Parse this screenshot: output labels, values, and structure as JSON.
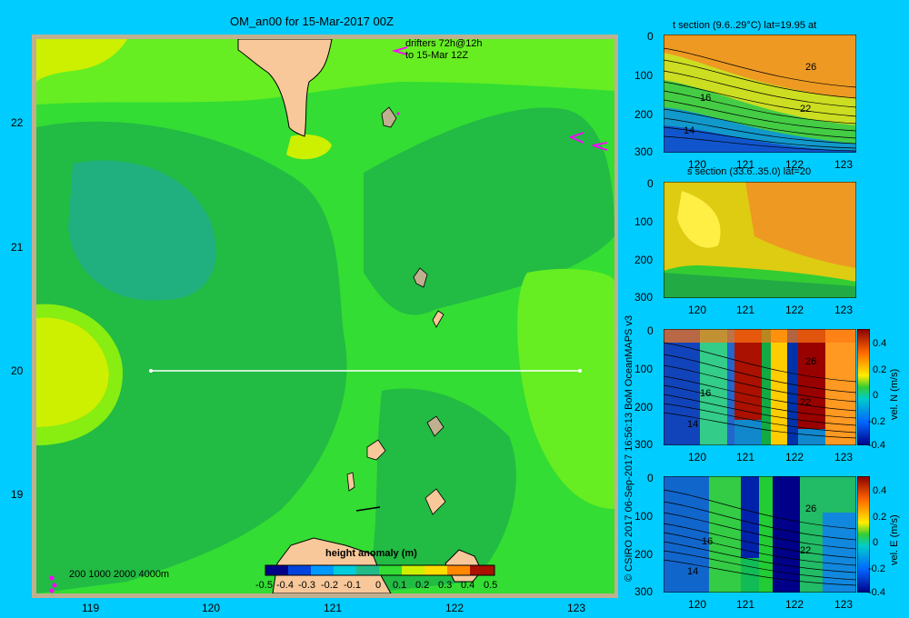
{
  "main_map": {
    "title": "OM_an00 for 15-Mar-2017 00Z",
    "drifters_line1": "drifters 72h@12h",
    "drifters_line2": "to 15-Mar 12Z",
    "y_ticks": [
      "22",
      "21",
      "20",
      "19"
    ],
    "x_ticks": [
      "119",
      "120",
      "121",
      "122",
      "123"
    ],
    "depth_legend": "200  1000  2000  4000m",
    "colorbar_title": "height anomaly (m)",
    "colorbar_ticks": [
      "-0.5",
      "-0.4",
      "-0.3",
      "-0.2",
      "-0.1",
      "0",
      "0.1",
      "0.2",
      "0.3",
      "0.4",
      "0.5"
    ],
    "colors": {
      "background": "#00ccff",
      "frame": "#c0b090",
      "land": "#f8c89a"
    }
  },
  "credit": "© CSIRO 2017   06-Sep-2017 16:56:13 BoM OceanMAPS v3",
  "sections": [
    {
      "title": "t section (9.6..29°C) lat=19.95 at",
      "y_ticks": [
        "0",
        "100",
        "200",
        "300"
      ],
      "x_ticks": [
        "120",
        "121",
        "122",
        "123"
      ],
      "contour_labels": [
        "26",
        "16",
        "22",
        "14"
      ]
    },
    {
      "title": "s section (33.6..35.0) lat=20",
      "y_ticks": [
        "0",
        "100",
        "200",
        "300"
      ],
      "x_ticks": [
        "120",
        "121",
        "122",
        "123"
      ]
    },
    {
      "title": "",
      "y_ticks": [
        "0",
        "100",
        "200",
        "300"
      ],
      "x_ticks": [
        "120",
        "121",
        "122",
        "123"
      ],
      "contour_labels": [
        "26",
        "16",
        "22",
        "14"
      ],
      "colorbar_label": "vel. N (m/s)",
      "colorbar_ticks": [
        "0.4",
        "0.2",
        "0",
        "-0.2",
        "-0.4"
      ]
    },
    {
      "title": "",
      "y_ticks": [
        "0",
        "100",
        "200",
        "300"
      ],
      "x_ticks": [
        "120",
        "121",
        "122",
        "123"
      ],
      "contour_labels": [
        "26",
        "16",
        "22",
        "14"
      ],
      "colorbar_label": "vel. E (m/s)",
      "colorbar_ticks": [
        "0.4",
        "0.2",
        "0",
        "-0.2",
        "-0.4"
      ]
    }
  ]
}
